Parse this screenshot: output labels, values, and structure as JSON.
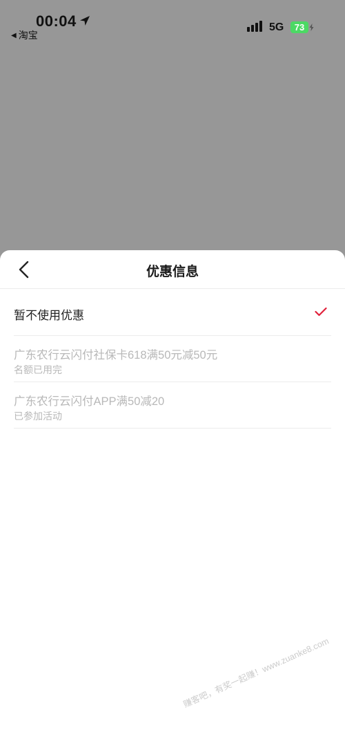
{
  "status_bar": {
    "time": "00:04",
    "back_app": "淘宝",
    "network": "5G",
    "battery": "73"
  },
  "sheet": {
    "title": "优惠信息",
    "options": [
      {
        "label": "暂不使用优惠",
        "selected": true
      },
      {
        "label": "广东农行云闪付社保卡618满50元减50元",
        "sublabel": "名额已用完",
        "disabled": true
      },
      {
        "label": "广东农行云闪付APP满50减20",
        "sublabel": "已参加活动",
        "disabled": true
      }
    ]
  },
  "watermark": "赚客吧，有奖一起赚！www.zuanke8.com",
  "colors": {
    "overlay": "#979797",
    "check": "#e0203a",
    "battery": "#4cd964",
    "disabled_text": "#b8b8b8"
  }
}
